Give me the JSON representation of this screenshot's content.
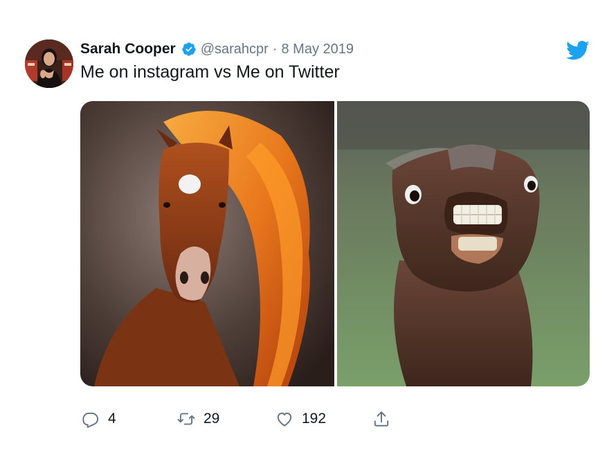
{
  "tweet": {
    "author": {
      "display_name": "Sarah Cooper",
      "handle": "@sarahcpr",
      "verified": true,
      "avatar": "profile-photo"
    },
    "separator": "·",
    "date": "8 May 2019",
    "text": "Me on instagram vs Me on Twitter",
    "media": [
      {
        "description_icon": "majestic-horse-photo"
      },
      {
        "description_icon": "goofy-horse-photo"
      }
    ],
    "actions": {
      "replies": "4",
      "retweets": "29",
      "likes": "192"
    },
    "icons": {
      "reply": "reply-icon",
      "retweet": "retweet-icon",
      "like": "heart-icon",
      "share": "share-icon",
      "brand": "twitter-bird-icon",
      "verified": "verified-badge-icon"
    },
    "colors": {
      "brand": "#1da1f2",
      "text": "#14171a",
      "secondary_text": "#657786",
      "icon_gray": "#657786"
    }
  }
}
